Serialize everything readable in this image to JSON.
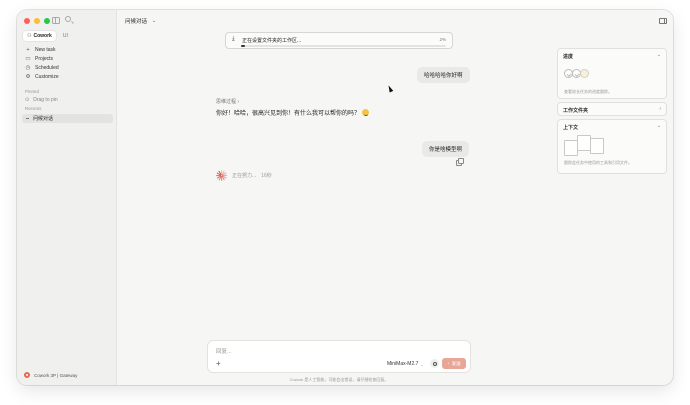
{
  "sidebar": {
    "tabs": [
      {
        "label": "Cowork",
        "icon": "people-icon"
      },
      {
        "label": "UI"
      }
    ],
    "nav": [
      {
        "label": "New task",
        "icon": "plus-icon"
      },
      {
        "label": "Projects",
        "icon": "folder-icon"
      },
      {
        "label": "Scheduled",
        "icon": "clock-icon"
      },
      {
        "label": "Customize",
        "icon": "sliders-icon"
      }
    ],
    "pinned_label": "Pinned",
    "pinned_hint": "Drag to pin",
    "recents_label": "Recents",
    "recent_item": "问候对话",
    "footer": "Cowork 3P | Gateway"
  },
  "topbar": {
    "title": "问候对话"
  },
  "download": {
    "text": "正在设置文件夹的工作区...",
    "percent_label": "2%",
    "progress": 0.02
  },
  "chat": {
    "user_message_1": "哈哈哈哈你好啊",
    "thinking_label": "思维过程 ›",
    "assistant_reply": "你好！哈哈，很高兴见到你！有什么我可以帮你的吗？",
    "user_message_2": "你是啥模型啊",
    "status_text": "正在努力...",
    "elapsed": "16秒"
  },
  "composer": {
    "placeholder": "回复...",
    "model": "MiniMax-M2.7",
    "send_label": "发送",
    "disclaimer": "Cowork 是人工智能，可能会出错误，请仔细检查回复。"
  },
  "right_panel": {
    "progress_title": "进度",
    "progress_desc": "查看较长任务的进度跟踪。",
    "workfolder_title": "工作文件夹",
    "context_title": "上下文",
    "context_desc": "跟踪此任务中使用的工具和引用文件。"
  },
  "colors": {
    "accent": "#d8553a",
    "send_disabled": "#e8a696"
  }
}
